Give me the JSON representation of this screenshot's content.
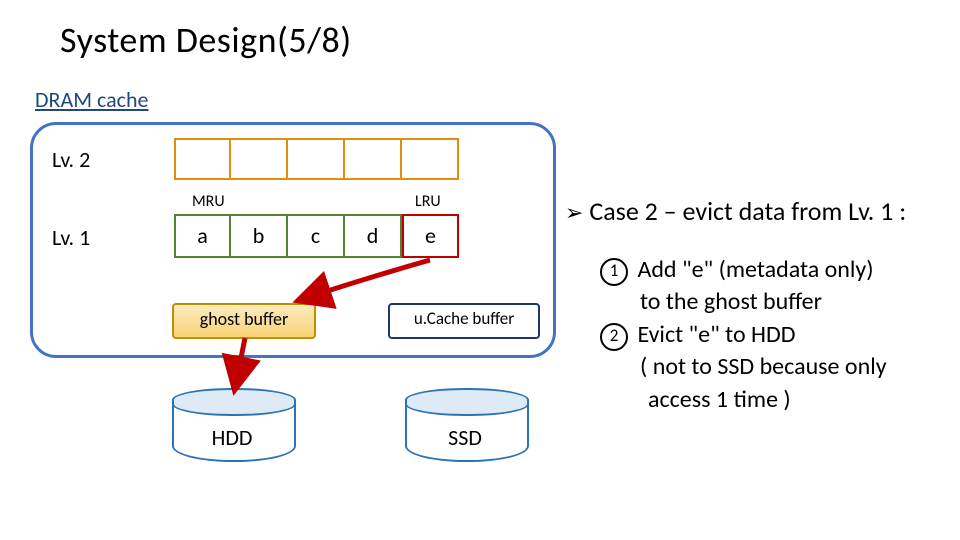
{
  "title": "System Design(5/8)",
  "dram_label": "DRAM cache",
  "levels": {
    "lv2": "Lv. 2",
    "lv1": "Lv. 1"
  },
  "mru": "MRU",
  "lru": "LRU",
  "lv1_cells": {
    "a": "a",
    "b": "b",
    "c": "c",
    "d": "d",
    "e": "e"
  },
  "ghost_buffer": "ghost buffer",
  "ucache_buffer": "u.Cache buffer",
  "hdd": "HDD",
  "ssd": "SSD",
  "case_line": "Case 2 – evict data from Lv. 1 :",
  "steps": {
    "s1a": "Add \"e\" (metadata only)",
    "s1b": "to the ghost buffer",
    "s2a": "Evict \"e\" to HDD",
    "s2b": "( not to SSD because only",
    "s2c": "access 1 time )",
    "n1": "1",
    "n2": "2"
  }
}
